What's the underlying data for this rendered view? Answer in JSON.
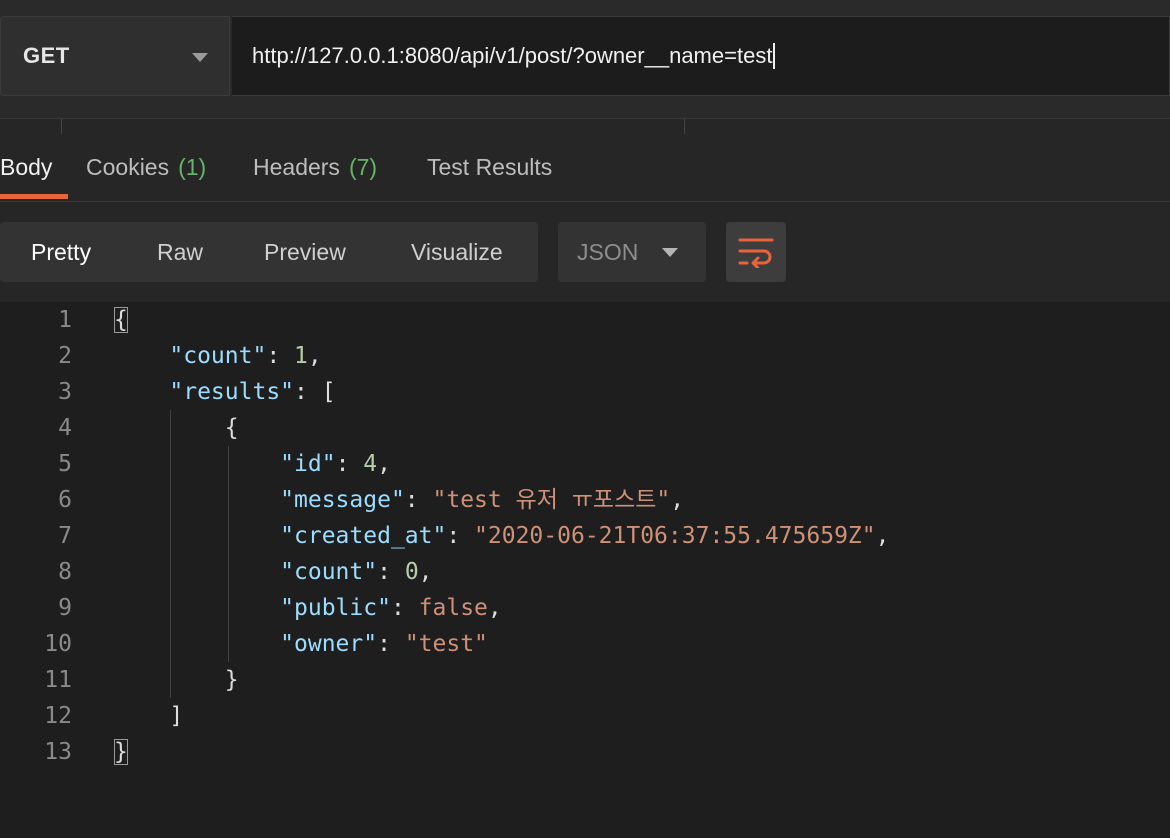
{
  "request": {
    "method": "GET",
    "url": "http://127.0.0.1:8080/api/v1/post/?owner__name=test"
  },
  "response_tabs": [
    {
      "label": "Body"
    },
    {
      "label": "Cookies",
      "count": "(1)"
    },
    {
      "label": "Headers",
      "count": "(7)"
    },
    {
      "label": "Test Results"
    }
  ],
  "view_modes": [
    "Pretty",
    "Raw",
    "Preview",
    "Visualize"
  ],
  "format": "JSON",
  "icons": {
    "method_caret": "chevron-down-icon",
    "format_caret": "chevron-down-icon",
    "wrap": "wrap-lines-icon"
  },
  "colors": {
    "accent": "#e8643a",
    "count_green": "#66b566",
    "json_key": "#9cdcfe",
    "json_number": "#b5cea8",
    "json_string": "#ce9178"
  },
  "code": {
    "line_numbers": [
      "1",
      "2",
      "3",
      "4",
      "5",
      "6",
      "7",
      "8",
      "9",
      "10",
      "11",
      "12",
      "13"
    ],
    "l1_open": "{",
    "l2_key": "\"count\"",
    "l2_val": "1",
    "l3_key": "\"results\"",
    "l3_open": "[",
    "l4_open": "{",
    "l5_key": "\"id\"",
    "l5_val": "4",
    "l6_key": "\"message\"",
    "l6_val": "\"test 유저 ㅠ포스트\"",
    "l7_key": "\"created_at\"",
    "l7_val": "\"2020-06-21T06:37:55.475659Z\"",
    "l8_key": "\"count\"",
    "l8_val": "0",
    "l9_key": "\"public\"",
    "l9_val": "false",
    "l10_key": "\"owner\"",
    "l10_val": "\"test\"",
    "l11_close": "}",
    "l12_close": "]",
    "l13_close": "}"
  }
}
